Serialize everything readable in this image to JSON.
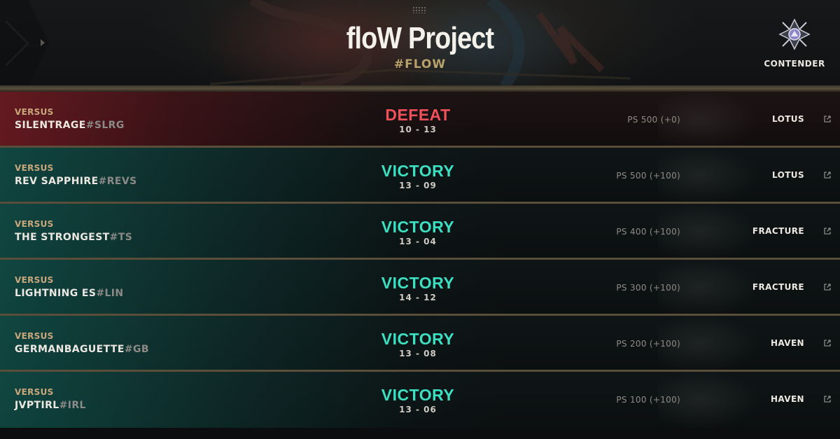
{
  "header": {
    "team_name": "floW Project",
    "team_tag": "#FLOW",
    "rank": {
      "label": "CONTENDER",
      "icon": "contender-rank-icon"
    }
  },
  "matches": [
    {
      "versus_label": "VERSUS",
      "opponent": "SILENTRAGE",
      "opponent_tag": "#SLRG",
      "result": "DEFEAT",
      "outcome": "defeat",
      "score": "10 - 13",
      "ps": "PS 500 (+0)",
      "map": "LOTUS"
    },
    {
      "versus_label": "VERSUS",
      "opponent": "REV SAPPHIRE",
      "opponent_tag": "#REVS",
      "result": "VICTORY",
      "outcome": "victory",
      "score": "13 - 09",
      "ps": "PS 500 (+100)",
      "map": "LOTUS"
    },
    {
      "versus_label": "VERSUS",
      "opponent": "THE STRONGEST",
      "opponent_tag": "#TS",
      "result": "VICTORY",
      "outcome": "victory",
      "score": "13 - 04",
      "ps": "PS 400 (+100)",
      "map": "FRACTURE"
    },
    {
      "versus_label": "VERSUS",
      "opponent": "LIGHTNING ES",
      "opponent_tag": "#LIN",
      "result": "VICTORY",
      "outcome": "victory",
      "score": "14 - 12",
      "ps": "PS 300 (+100)",
      "map": "FRACTURE"
    },
    {
      "versus_label": "VERSUS",
      "opponent": "GERMANBAGUETTE",
      "opponent_tag": "#GB",
      "result": "VICTORY",
      "outcome": "victory",
      "score": "13 - 08",
      "ps": "PS 200 (+100)",
      "map": "HAVEN"
    },
    {
      "versus_label": "VERSUS",
      "opponent": "JVPTIRL",
      "opponent_tag": "#IRL",
      "result": "VICTORY",
      "outcome": "victory",
      "score": "13 - 06",
      "ps": "PS 100 (+100)",
      "map": "HAVEN"
    }
  ],
  "colors": {
    "defeat": "#f0505a",
    "victory": "#3cdfc2",
    "versus": "#c8a77b",
    "tag": "#b7a06a"
  },
  "icons": {
    "external_link": "external-link-icon"
  }
}
